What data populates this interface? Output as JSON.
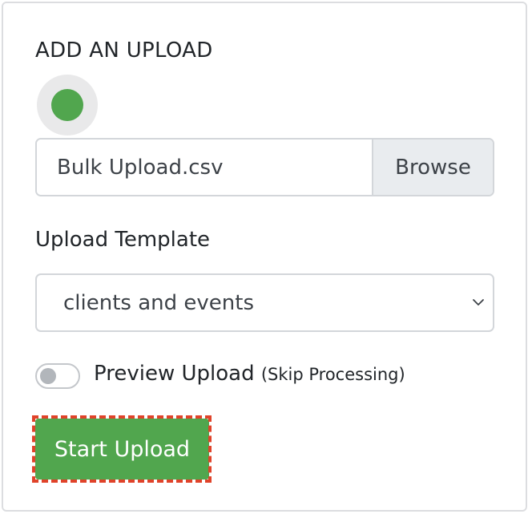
{
  "upload": {
    "title": "ADD AN UPLOAD",
    "status_color": "#51a64e",
    "file_name": "Bulk Upload.csv",
    "browse_label": "Browse",
    "template_label": "Upload Template",
    "template_value": "clients and events",
    "preview_label": "Preview Upload",
    "preview_note": "(Skip Processing)",
    "preview_enabled": false,
    "start_label": "Start Upload"
  },
  "colors": {
    "accent_green": "#51a64e",
    "highlight_red": "#e0432a"
  },
  "icons": {
    "select_caret": "chevron-down-icon"
  }
}
